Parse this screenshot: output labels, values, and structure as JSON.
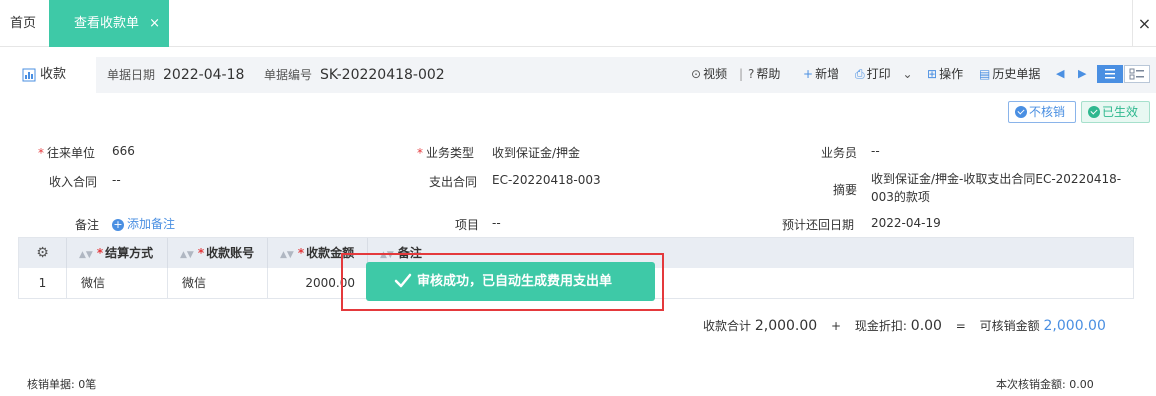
{
  "tabs": {
    "home_label": "首页",
    "active_label": "查看收款单",
    "active_close": "×",
    "close_all": "×"
  },
  "header": {
    "doc_type": "收款",
    "doc_date_label": "单据日期",
    "doc_date": "2022-04-18",
    "doc_no_label": "单据编号",
    "doc_no": "SK-20220418-002"
  },
  "toolbar": {
    "video": "视频",
    "separator": "|",
    "help": "帮助",
    "add": "新增",
    "print": "打印",
    "operate": "操作",
    "history": "历史单据"
  },
  "status": {
    "unverified": "不核销",
    "effective": "已生效"
  },
  "form": {
    "partner_label": "往来单位",
    "partner": "666",
    "biz_type_label": "业务类型",
    "biz_type": "收到保证金/押金",
    "salesman_label": "业务员",
    "salesman": "--",
    "income_contract_label": "收入合同",
    "income_contract": "--",
    "expense_contract_label": "支出合同",
    "expense_contract": "EC-20220418-003",
    "summary_label": "摘要",
    "summary": "收到保证金/押金-收取支出合同EC-20220418-003的款项",
    "remark_label": "备注",
    "add_remark": "添加备注",
    "project_label": "项目",
    "project": "--",
    "return_date_label": "预计还回日期",
    "return_date": "2022-04-19"
  },
  "table": {
    "headers": [
      "结算方式",
      "收款账号",
      "收款金额",
      "备注"
    ],
    "rows": [
      {
        "index": "1",
        "method": "微信",
        "account": "微信",
        "amount": "2000.00",
        "remark": ""
      }
    ]
  },
  "toast": {
    "message": "审核成功，已自动生成费用支出单"
  },
  "totals": {
    "receipt_total_label": "收款合计",
    "receipt_total": "2,000.00",
    "plus": "+",
    "discount_label": "现金折扣:",
    "discount": "0.00",
    "equals": "=",
    "verifiable_label": "可核销金额",
    "verifiable": "2,000.00"
  },
  "footer": {
    "verify_docs": "核销单据: 0笔",
    "current_verify": "本次核销金额: 0.00"
  },
  "colors": {
    "accent": "#3ec9a7",
    "link": "#4a8fe2",
    "required": "#e4393c"
  }
}
